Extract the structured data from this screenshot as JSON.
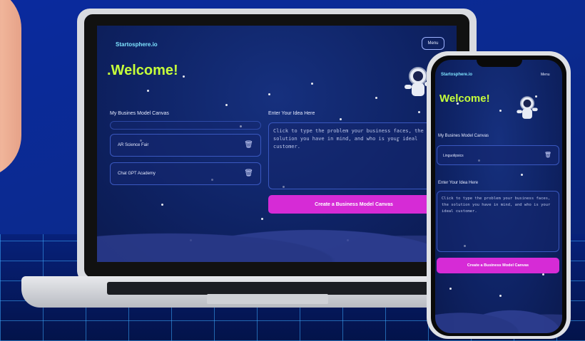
{
  "laptop": {
    "brand": "Startosphere.io",
    "menu_label": "Menu",
    "welcome": ".Welcome!",
    "canvas_label": "My Busines Model Canvas",
    "idea_label": "Enter Your Idea Here",
    "cards": [
      {
        "label": "AR Science Fair"
      },
      {
        "label": "Chat GPT Academy"
      }
    ],
    "idea_placeholder": "Click to type the problem your business faces, the solution you have in mind, and who is your ideal customer.",
    "cta_label": "Create a Business Model Canvas"
  },
  "phone": {
    "brand": "Startosphere.io",
    "menu_label": "Menu",
    "welcome": "Welcome!",
    "canvas_label": "My Busines Model Canvas",
    "cards": [
      {
        "label": "Linguolipsics"
      }
    ],
    "idea_label": "Enter Your Idea Here",
    "idea_placeholder": "Click to type the problem your business faces, the solution you have in mind, and who is your ideal customer.",
    "cta_label": "Create a Business Model Canvas"
  },
  "icons": {
    "trash": "trash-icon",
    "astronaut": "astronaut-icon"
  },
  "colors": {
    "accent_cta": "#d62bd6",
    "welcome_text": "#c6ff3a",
    "brand_text": "#7ee3ff",
    "background": "#0b2a8f"
  }
}
